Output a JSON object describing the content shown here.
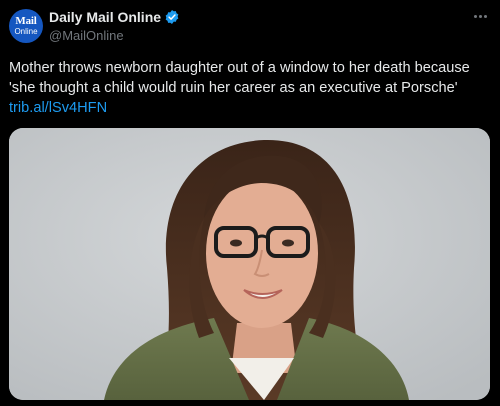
{
  "account": {
    "avatar_text_line1": "Mail",
    "avatar_text_line2": "Online",
    "display_name": "Daily Mail Online",
    "handle": "@MailOnline",
    "verified_icon": "verified-badge-icon",
    "verified_color": "#1d9bf0"
  },
  "tweet": {
    "text_line1": "Mother throws newborn daughter out of a window to her death because",
    "text_line2": "'she thought a child would ruin her career as an executive at Porsche'",
    "link_text": "trib.al/lSv4HFN"
  },
  "menu": {
    "more_icon": "more-options-icon"
  },
  "media": {
    "icon": "photo-woman-portrait"
  },
  "colors": {
    "background": "#000000",
    "text": "#e7e9ea",
    "secondary_text": "#71767b",
    "link": "#1d9bf0",
    "avatar_bg": "#1557c0"
  }
}
